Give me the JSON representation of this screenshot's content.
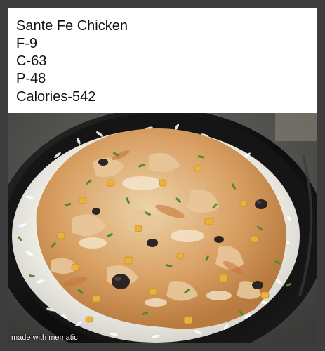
{
  "caption": {
    "title": "Sante Fe Chicken",
    "fat": "F-9",
    "carbs": "C-63",
    "protein": "P-48",
    "calories": "Calories-542"
  },
  "photo": {
    "subject": "black meal-prep bowl with white rice topped with creamy chicken, corn, black beans and chives"
  },
  "watermark": "made with mematic",
  "colors": {
    "frame": "#3d3d3d",
    "caption_bg": "#ffffff",
    "caption_text": "#111111",
    "bowl": "#111111",
    "rice": "#f1efe9",
    "chicken_sauce": "#d9a66a",
    "corn": "#e8b23c",
    "black_bean": "#2a2424",
    "chive": "#4e8a2e"
  }
}
